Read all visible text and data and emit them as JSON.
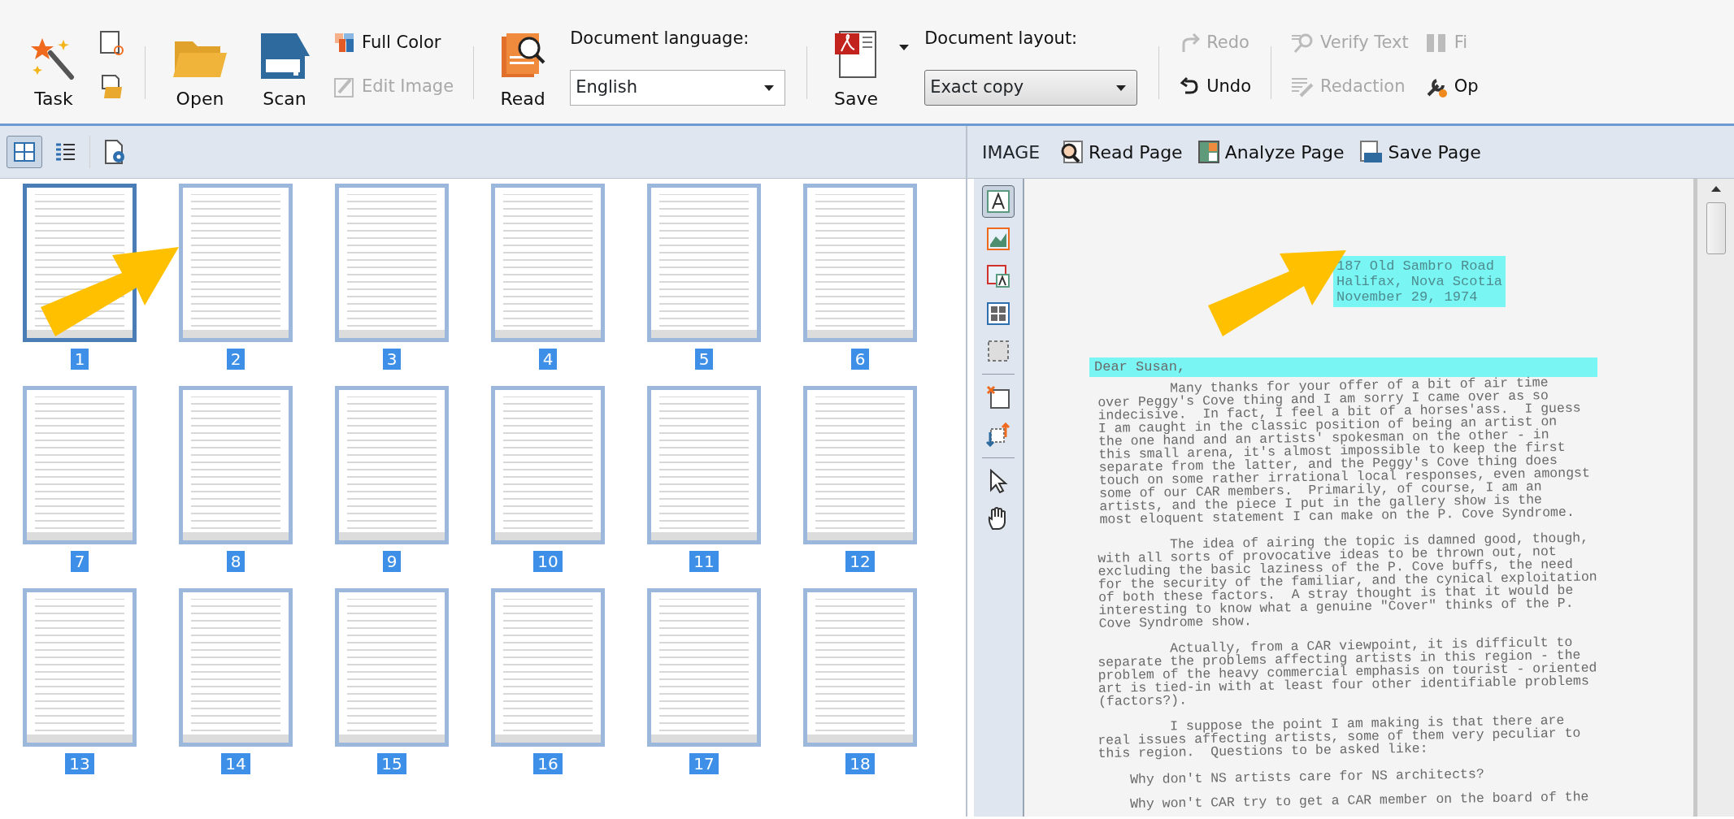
{
  "toolbar": {
    "task": "Task",
    "open": "Open",
    "scan": "Scan",
    "full_color": {
      "label": "Full Color",
      "disabled": false
    },
    "edit_image": {
      "label": "Edit Image",
      "disabled": true
    },
    "read": "Read",
    "language_label": "Document language:",
    "language": "English",
    "save": "Save",
    "layout_label": "Document layout:",
    "layout": "Exact copy",
    "redo": {
      "label": "Redo",
      "disabled": true
    },
    "undo": {
      "label": "Undo",
      "disabled": false
    },
    "verify_text": {
      "label": "Verify Text",
      "disabled": true
    },
    "redaction": {
      "label": "Redaction",
      "disabled": true
    },
    "find": {
      "label": "Fi",
      "disabled": true
    },
    "options": {
      "label": "Op",
      "disabled": false
    }
  },
  "view_modes": [
    {
      "selected": true
    },
    {
      "selected": false
    }
  ],
  "pages": [
    {
      "number": "1",
      "selected": true
    },
    {
      "number": "2",
      "selected": false
    },
    {
      "number": "3",
      "selected": false
    },
    {
      "number": "4",
      "selected": false
    },
    {
      "number": "5",
      "selected": false
    },
    {
      "number": "6",
      "selected": false
    },
    {
      "number": "7",
      "selected": false
    },
    {
      "number": "8",
      "selected": false
    },
    {
      "number": "9",
      "selected": false
    },
    {
      "number": "10",
      "selected": false
    },
    {
      "number": "11",
      "selected": false
    },
    {
      "number": "12",
      "selected": false
    },
    {
      "number": "13",
      "selected": false
    },
    {
      "number": "14",
      "selected": false
    },
    {
      "number": "15",
      "selected": false
    },
    {
      "number": "16",
      "selected": false
    },
    {
      "number": "17",
      "selected": false
    },
    {
      "number": "18",
      "selected": false
    }
  ],
  "image_toolbar": {
    "title": "IMAGE",
    "buttons": [
      "Read Page",
      "Analyze Page",
      "Save Page"
    ]
  },
  "tools": [
    {
      "selected": true
    },
    {
      "selected": false
    },
    {
      "selected": false
    },
    {
      "selected": false
    },
    {
      "selected": false
    },
    {
      "selected": false
    },
    {
      "selected": false
    },
    {
      "selected": false
    },
    {
      "selected": false
    }
  ],
  "document": {
    "address": [
      "187 Old Sambro Road",
      "Halifax, Nova Scotia",
      "November 29, 1974"
    ],
    "salutation": "Dear Susan,",
    "paragraphs": [
      [
        "Many thanks for your offer of a bit of air time",
        "over Peggy's Cove thing and I am sorry I came over as so",
        "indecisive.  In fact, I feel a bit of a horses'ass.  I guess",
        "I am caught in the classic position of being an artist on",
        "the one hand and an artists' spokesman on the other - in",
        "this small arena, it's almost impossible to keep the first",
        "separate from the latter, and the Peggy's Cove thing does",
        "touch on some rather irrational local responses, even amongst",
        "some of our CAR members.  Primarily, of course, I am an",
        "artists, and the piece I put in the gallery show is the",
        "most eloquent statement I can make on the P. Cove Syndrome."
      ],
      [
        "The idea of airing the topic is damned good, though,",
        "with all sorts of provocative ideas to be thrown out, not",
        "excluding the basic laziness of the P. Cove buffs, the need",
        "for the security of the familiar, and the cynical exploitation",
        "of both these factors.  A stray thought is that it would be",
        "interesting to know what a genuine \"Cover\" thinks of the P.",
        "Cove Syndrome show."
      ],
      [
        "Actually, from a CAR viewpoint, it is difficult to",
        "separate the problems affecting artists in this region - the",
        "problem of the heavy commercial emphasis on tourist - oriented",
        "art is tied-in with at least four other identifiable problems",
        "(factors?)."
      ],
      [
        "I suppose the point I am making is that there are",
        "real issues affecting artists, some of them very peculiar to",
        "this region.  Questions to be asked like:"
      ]
    ],
    "questions": [
      "Why don't NS artists care for NS architects?",
      "Why won't CAR try to get a CAR member on the board of the"
    ]
  }
}
